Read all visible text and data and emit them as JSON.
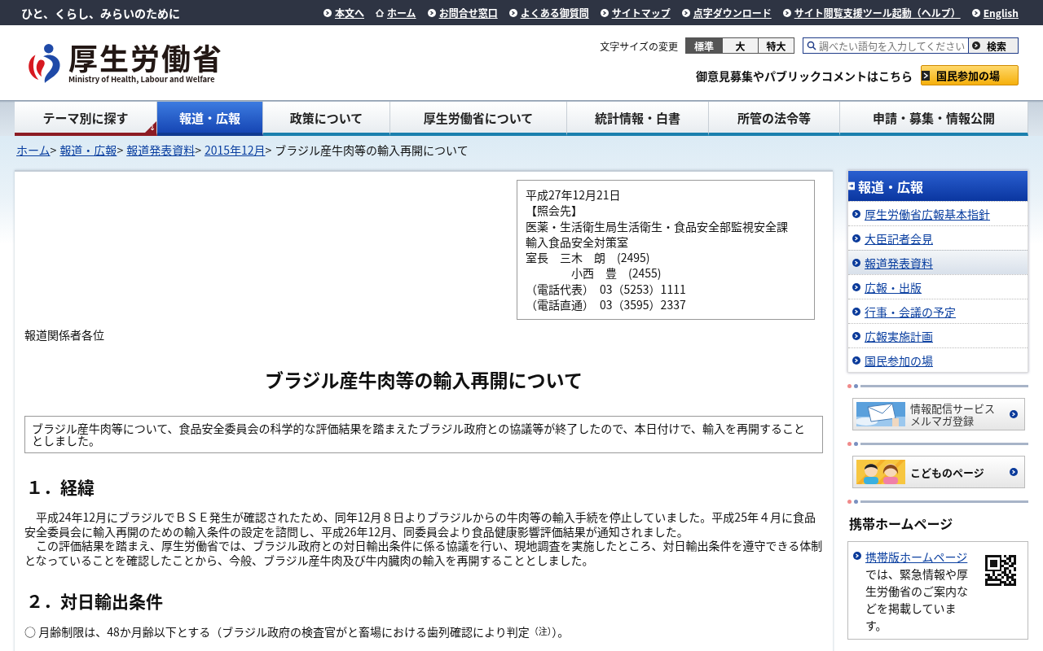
{
  "top_bar": {
    "tagline": "ひと、くらし、みらいのために",
    "links": [
      {
        "label": "本文へ",
        "kind": "arrow"
      },
      {
        "label": "ホーム",
        "kind": "home"
      },
      {
        "label": "お問合せ窓口",
        "kind": "arrow"
      },
      {
        "label": "よくある御質問",
        "kind": "arrow"
      },
      {
        "label": "サイトマップ",
        "kind": "arrow"
      },
      {
        "label": "点字ダウンロード",
        "kind": "arrow"
      },
      {
        "label": "サイト閲覧支援ツール起動（ヘルプ）",
        "kind": "arrow"
      },
      {
        "label": "English",
        "kind": "arrow"
      }
    ]
  },
  "header": {
    "logo_title": "厚生労働省",
    "logo_subtitle": "Ministry of Health, Labour and Welfare",
    "font_size_label": "文字サイズの変更",
    "font_sizes": [
      {
        "label": "標準",
        "selected": true
      },
      {
        "label": "大",
        "selected": false
      },
      {
        "label": "特大",
        "selected": false
      }
    ],
    "search": {
      "placeholder": "調べたい語句を入力してください",
      "button": "検索"
    },
    "public_comment": "御意見募集やパブリックコメントはこちら",
    "participation_button": "国民参加の場"
  },
  "nav": [
    {
      "label": "テーマ別に探す",
      "selected": false,
      "kind": "theme"
    },
    {
      "label": "報道・広報",
      "selected": true,
      "kind": "tab"
    },
    {
      "label": "政策について",
      "selected": false,
      "kind": "tab"
    },
    {
      "label": "厚生労働省について",
      "selected": false,
      "kind": "tab"
    },
    {
      "label": "統計情報・白書",
      "selected": false,
      "kind": "tab"
    },
    {
      "label": "所管の法令等",
      "selected": false,
      "kind": "tab"
    },
    {
      "label": "申請・募集・情報公開",
      "selected": false,
      "kind": "tab"
    }
  ],
  "breadcrumb": {
    "links": [
      {
        "label": "ホーム",
        "separator": ">"
      },
      {
        "label": "報道・広報",
        "separator": ">"
      },
      {
        "label": "報道発表資料",
        "separator": ">"
      },
      {
        "label": "2015年12月",
        "separator": ">"
      }
    ],
    "current": "ブラジル産牛肉等の輸入再開について"
  },
  "article": {
    "contact_lines": [
      "平成27年12月21日",
      "【照会先】",
      "医薬・生活衛生局生活衛生・食品安全部監視安全課",
      "輸入食品安全対策室",
      "室長　三木　朗　(2495)",
      "　　　　小西　豊　(2455)",
      "（電話代表）　03（5253）1111",
      "（電話直通）　03（3595）2337"
    ],
    "addressee": "報道関係者各位",
    "title": "ブラジル産牛肉等の輸入再開について",
    "summary": "ブラジル産牛肉等について、食品安全委員会の科学的な評価結果を踏まえたブラジル政府との協議等が終了したので、本日付けで、輸入を再開することとしました。",
    "sections": [
      {
        "heading": "１．経緯",
        "paragraphs": [
          "　平成24年12月にブラジルでＢＳＥ発生が確認されたため、同年12月８日よりブラジルからの牛肉等の輸入手続を停止していました。平成25年４月に食品安全委員会に輸入再開のための輸入条件の設定を諮問し、平成26年12月、同委員会より食品健康影響評価結果が通知されました。",
          "　この評価結果を踏まえ、厚生労働省では、ブラジル政府との対日輸出条件に係る協議を行い、現地調査を実施したところ、対日輸出条件を遵守できる体制となっていることを確認したことから、今般、ブラジル産牛肉及び牛内臓肉の輸入を再開することとしました。"
        ]
      },
      {
        "heading": "２．対日輸出条件",
        "paragraphs": [
          "○ 月齢制限は、48か月齢以下とする（ブラジル政府の検査官がと畜場における歯列確認により判定$^{（注）}$）。"
        ]
      }
    ]
  },
  "sidebar": {
    "menu_title": "報道・広報",
    "menu_items": [
      {
        "label": "厚生労働省広報基本指針",
        "selected": false
      },
      {
        "label": "大臣記者会見",
        "selected": false
      },
      {
        "label": "報道発表資料",
        "selected": true
      },
      {
        "label": "広報・出版",
        "selected": false
      },
      {
        "label": "行事・会議の予定",
        "selected": false
      },
      {
        "label": "広報実施計画",
        "selected": false
      },
      {
        "label": "国民参加の場",
        "selected": false
      }
    ],
    "banners": [
      {
        "lines": [
          "情報配信サービス",
          "メルマガ登録"
        ],
        "kind": "mail"
      },
      {
        "lines": [
          "こどものページ"
        ],
        "kind": "kids"
      }
    ],
    "mobile": {
      "heading": "携帯ホームページ",
      "link": "携帯版ホームページ",
      "text": "では、緊急情報や厚生労働省のご案内などを掲載しています。"
    }
  }
}
